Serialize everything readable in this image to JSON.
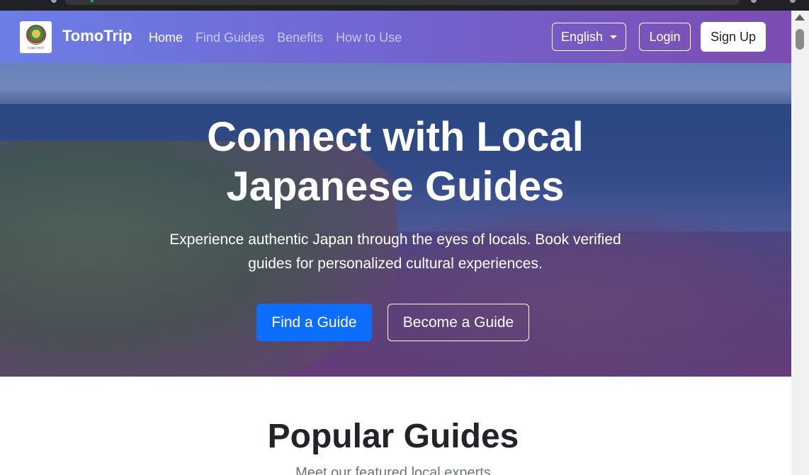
{
  "navbar": {
    "brand": "TomoTrip",
    "logo_text": "TOMOTRIP",
    "links": [
      {
        "label": "Home",
        "active": true
      },
      {
        "label": "Find Guides",
        "active": false
      },
      {
        "label": "Benefits",
        "active": false
      },
      {
        "label": "How to Use",
        "active": false
      }
    ],
    "language": "English",
    "login": "Login",
    "signup": "Sign Up"
  },
  "hero": {
    "title": "Connect with Local Japanese Guides",
    "subtitle": "Experience authentic Japan through the eyes of locals. Book verified guides for personalized cultural experiences.",
    "primary_button": "Find a Guide",
    "secondary_button": "Become a Guide"
  },
  "popular_guides": {
    "title": "Popular Guides",
    "subtitle": "Meet our featured local experts"
  },
  "colors": {
    "primary": "#0d6efd",
    "navbar_start": "#6c7ee6",
    "navbar_end": "#7c4cb0",
    "heading": "#212529"
  }
}
